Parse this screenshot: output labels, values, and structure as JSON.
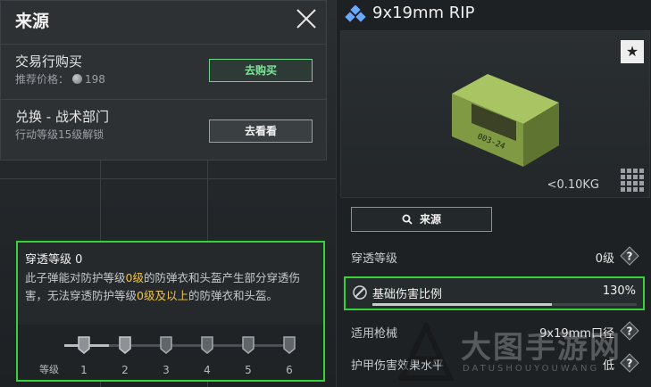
{
  "source": {
    "title": "来源",
    "rows": [
      {
        "title": "交易行购买",
        "sub_label": "推荐价格：",
        "price": "198",
        "button": "去购买"
      },
      {
        "title": "兑换 - 战术部门",
        "sub_label": "行动等级15级解锁",
        "button": "去看看"
      }
    ]
  },
  "penetration": {
    "title": "穿透等级 0",
    "desc_parts": [
      "此子弹能对防护等级",
      "0级",
      "的防弹衣和头盔产生部分穿透伤害，无法穿透防护等级",
      "0级及以上",
      "的防弹衣和头盔。"
    ],
    "scale_label": "等级",
    "scale_ticks": [
      "1",
      "2",
      "3",
      "4",
      "5",
      "6"
    ],
    "current_level": 0
  },
  "item": {
    "name": "9x19mm RIP",
    "weight": "<0.10KG",
    "box_label": "003-24",
    "source_button": "来源",
    "stats": [
      {
        "label": "穿透等级",
        "value": "0级"
      },
      {
        "label": "基础伤害比例",
        "value": "130%",
        "bar_fraction": 0.68
      },
      {
        "label": "适用枪械",
        "value": "9x19mm口径"
      },
      {
        "label": "护甲伤害效果水平",
        "value": "低"
      }
    ]
  },
  "watermark": {
    "main": "大图手游网",
    "sub": "DATUSHOUYOUWANG"
  },
  "colors": {
    "highlight": "#35d23a",
    "buy_accent": "#7fe39a",
    "level_highlight": "#f0c341"
  }
}
